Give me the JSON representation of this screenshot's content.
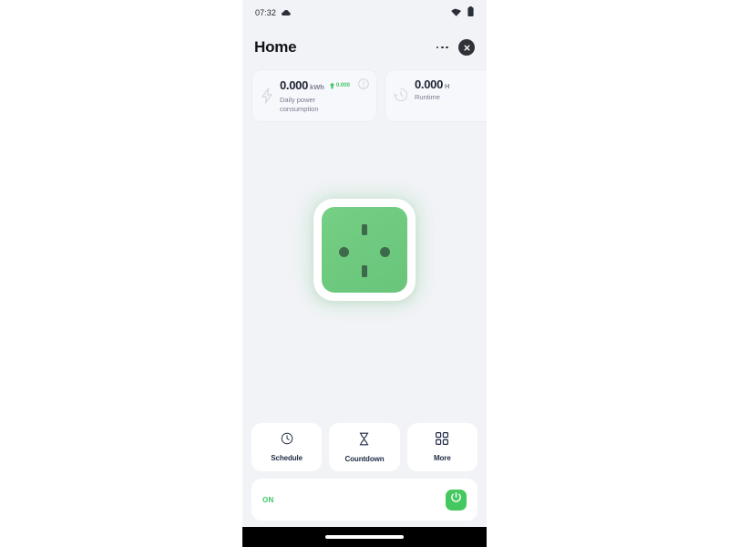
{
  "status_bar": {
    "time": "07:32",
    "cloud_icon": "cloud-icon",
    "wifi_icon": "wifi-icon",
    "battery_icon": "battery-icon"
  },
  "header": {
    "title": "Home",
    "menu_icon": "more-options-icon",
    "close_icon": "close-icon"
  },
  "metrics": [
    {
      "icon": "lightning-bolt-icon",
      "value": "0.000",
      "unit": "kWh",
      "trend_icon": "arrow-up-icon",
      "trend_value": "0.000",
      "label": "Daily power consumption",
      "info_icon": "info-icon"
    },
    {
      "icon": "history-clock-icon",
      "value": "0.000",
      "unit": "H",
      "label": "Runtime"
    }
  ],
  "device": {
    "graphic": "uk-power-socket-icon",
    "face_color": "#6ec97d",
    "pin_color": "#3e6a4c"
  },
  "actions": [
    {
      "icon": "clock-icon",
      "label": "Schedule"
    },
    {
      "icon": "hourglass-icon",
      "label": "Countdown"
    },
    {
      "icon": "grid-icon",
      "label": "More"
    }
  ],
  "power": {
    "state_label": "ON",
    "state_color": "#3fc463",
    "button_icon": "power-icon",
    "button_color": "#45c85f"
  },
  "nav": {
    "home_indicator": "home-indicator"
  }
}
